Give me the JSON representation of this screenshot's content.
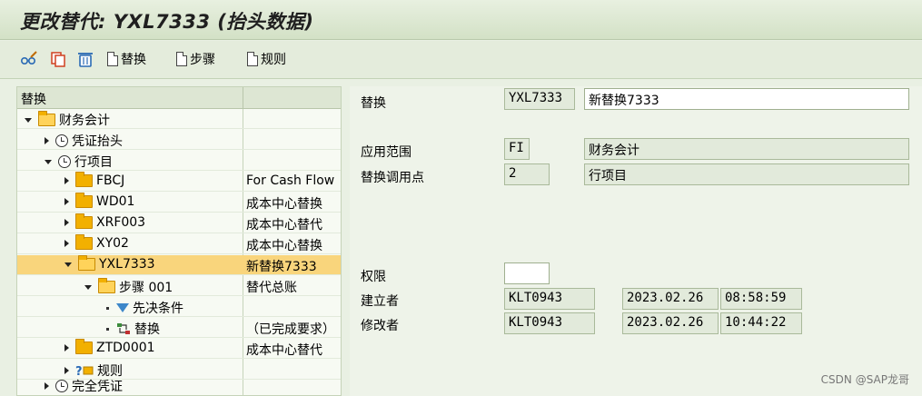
{
  "window": {
    "title": "更改替代: YXL7333 (抬头数据)"
  },
  "toolbar": {
    "icons": [
      "edit-glasses-icon",
      "copy-icon",
      "delete-icon"
    ],
    "substitution_label": "替换",
    "step_label": "步骤",
    "rule_label": "规则"
  },
  "tree": {
    "header": "替换",
    "rows": [
      {
        "label": "财务会计",
        "desc": ""
      },
      {
        "label": "凭证抬头",
        "desc": ""
      },
      {
        "label": "行项目",
        "desc": ""
      },
      {
        "label": "FBCJ",
        "desc": "For Cash Flow"
      },
      {
        "label": "WD01",
        "desc": "成本中心替换"
      },
      {
        "label": "XRF003",
        "desc": "成本中心替代"
      },
      {
        "label": "XY02",
        "desc": "成本中心替换"
      },
      {
        "label": "YXL7333",
        "desc": "新替换7333"
      },
      {
        "label": "步骤 001",
        "desc": "替代总账"
      },
      {
        "label": "先决条件",
        "desc": ""
      },
      {
        "label": "替换",
        "desc": "（已完成要求）"
      },
      {
        "label": "ZTD0001",
        "desc": "成本中心替代"
      },
      {
        "label": "规则",
        "desc": ""
      },
      {
        "label": "完全凭证",
        "desc": ""
      }
    ]
  },
  "form": {
    "substitution": {
      "label": "替换",
      "code": "YXL7333",
      "text": "新替换7333"
    },
    "app_area": {
      "label": "应用范围",
      "code": "FI",
      "text": "财务会计"
    },
    "callup_point": {
      "label": "替换调用点",
      "code": "2",
      "text": "行项目"
    },
    "auth": {
      "label": "权限",
      "value": ""
    },
    "created": {
      "label": "建立者",
      "user": "KLT0943",
      "date": "2023.02.26",
      "time": "08:58:59"
    },
    "changed": {
      "label": "修改者",
      "user": "KLT0943",
      "date": "2023.02.26",
      "time": "10:44:22"
    }
  },
  "watermark": "CSDN @SAP龙哥",
  "colors": {
    "selected_row": "#f9d57c",
    "folder": "#f2b000",
    "background": "#e9f0e3"
  }
}
